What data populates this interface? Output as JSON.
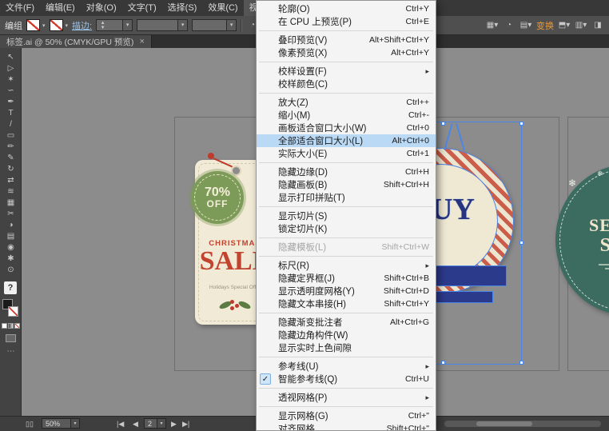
{
  "colors": {
    "menu_highlight": "#b9d9f5",
    "accent_orange": "#e89b3c",
    "selection_blue": "#4a86e8",
    "tag_cream": "#f1ead6",
    "tag_red": "#c2432e",
    "badge_green": "#7d9b58",
    "tag_teal": "#3c6b60"
  },
  "menubar": {
    "items": [
      {
        "name": "file",
        "label": "文件(F)"
      },
      {
        "name": "edit",
        "label": "编辑(E)"
      },
      {
        "name": "object",
        "label": "对象(O)"
      },
      {
        "name": "type",
        "label": "文字(T)"
      },
      {
        "name": "select",
        "label": "选择(S)"
      },
      {
        "name": "effect",
        "label": "效果(C)"
      },
      {
        "name": "view",
        "label": "视图(V)",
        "active": true
      }
    ]
  },
  "controlbar": {
    "group_label": "编组",
    "stroke_label": "描边:",
    "transform_label": "变换"
  },
  "document_tab": {
    "title": "标签.ai @ 50% (CMYK/GPU 预览)",
    "close": "×"
  },
  "toolbar": {
    "tools": [
      {
        "name": "selection-tool",
        "glyph": "↖"
      },
      {
        "name": "direct-selection-tool",
        "glyph": "▷"
      },
      {
        "name": "magic-wand-tool",
        "glyph": "✶"
      },
      {
        "name": "lasso-tool",
        "glyph": "∽"
      },
      {
        "name": "pen-tool",
        "glyph": "✒"
      },
      {
        "name": "type-tool",
        "glyph": "T"
      },
      {
        "name": "line-segment-tool",
        "glyph": "/"
      },
      {
        "name": "rectangle-tool",
        "glyph": "▭"
      },
      {
        "name": "paintbrush-tool",
        "glyph": "✏"
      },
      {
        "name": "pencil-tool",
        "glyph": "✎"
      },
      {
        "name": "rotate-tool",
        "glyph": "↻"
      },
      {
        "name": "scale-tool",
        "glyph": "⇄"
      },
      {
        "name": "width-tool",
        "glyph": "≋"
      },
      {
        "name": "shape-builder-tool",
        "glyph": "▦"
      },
      {
        "name": "scissors-tool",
        "glyph": "✂"
      },
      {
        "name": "gradient-tool",
        "glyph": "◑"
      },
      {
        "name": "mesh-tool",
        "glyph": "▤"
      },
      {
        "name": "blend-tool",
        "glyph": "◉"
      },
      {
        "name": "symbol-sprayer-tool",
        "glyph": "✱"
      },
      {
        "name": "zoom-tool",
        "glyph": "⊙"
      }
    ],
    "help_glyph": "?",
    "ellipsis": "⋯"
  },
  "view_menu": {
    "items": [
      {
        "label": "轮廓(O)",
        "shortcut": "Ctrl+Y"
      },
      {
        "label": "在 CPU 上预览(P)",
        "shortcut": "Ctrl+E"
      },
      {
        "type": "sep"
      },
      {
        "label": "叠印预览(V)",
        "shortcut": "Alt+Shift+Ctrl+Y"
      },
      {
        "label": "像素预览(X)",
        "shortcut": "Alt+Ctrl+Y"
      },
      {
        "type": "sep"
      },
      {
        "label": "校样设置(F)",
        "submenu": true
      },
      {
        "label": "校样颜色(C)"
      },
      {
        "type": "sep"
      },
      {
        "label": "放大(Z)",
        "shortcut": "Ctrl++"
      },
      {
        "label": "缩小(M)",
        "shortcut": "Ctrl+-"
      },
      {
        "label": "画板适合窗口大小(W)",
        "shortcut": "Ctrl+0"
      },
      {
        "label": "全部适合窗口大小(L)",
        "shortcut": "Alt+Ctrl+0",
        "highlight": true
      },
      {
        "label": "实际大小(E)",
        "shortcut": "Ctrl+1"
      },
      {
        "type": "sep"
      },
      {
        "label": "隐藏边缘(D)",
        "shortcut": "Ctrl+H"
      },
      {
        "label": "隐藏画板(B)",
        "shortcut": "Shift+Ctrl+H"
      },
      {
        "label": "显示打印拼贴(T)"
      },
      {
        "type": "sep"
      },
      {
        "label": "显示切片(S)"
      },
      {
        "label": "锁定切片(K)"
      },
      {
        "type": "sep"
      },
      {
        "label": "隐藏模板(L)",
        "shortcut": "Shift+Ctrl+W",
        "disabled": true
      },
      {
        "type": "sep"
      },
      {
        "label": "标尺(R)",
        "submenu": true
      },
      {
        "label": "隐藏定界框(J)",
        "shortcut": "Shift+Ctrl+B"
      },
      {
        "label": "显示透明度网格(Y)",
        "shortcut": "Shift+Ctrl+D"
      },
      {
        "label": "隐藏文本串接(H)",
        "shortcut": "Shift+Ctrl+Y"
      },
      {
        "type": "sep"
      },
      {
        "label": "隐藏渐变批注者",
        "shortcut": "Alt+Ctrl+G"
      },
      {
        "label": "隐藏边角构件(W)"
      },
      {
        "label": "显示实时上色间隙"
      },
      {
        "type": "sep"
      },
      {
        "label": "参考线(U)",
        "submenu": true
      },
      {
        "label": "智能参考线(Q)",
        "shortcut": "Ctrl+U",
        "checked": true
      },
      {
        "type": "sep"
      },
      {
        "label": "透视网格(P)",
        "submenu": true
      },
      {
        "type": "sep"
      },
      {
        "label": "显示网格(G)",
        "shortcut": "Ctrl+\""
      },
      {
        "label": "对齐网格",
        "shortcut": "Shift+Ctrl+\""
      }
    ]
  },
  "canvas": {
    "tag1": {
      "badge_line1": "70%",
      "badge_line2": "OFF",
      "title": "CHRISTMAS",
      "big": "SALE",
      "small": "Holidays Special Offer"
    },
    "tag2": {
      "visible_text": "UY"
    },
    "tag3": {
      "script": "Merry",
      "line1": "SEASON",
      "line2": "SALE",
      "snowflake": "❄"
    }
  },
  "status_bar": {
    "zoom": "50%",
    "zoom_arrow": "▾",
    "nav": {
      "first": "|◀",
      "prev": "◀",
      "value": "2",
      "value_arrow": "▾",
      "next": "▶",
      "last": "▶|"
    }
  }
}
